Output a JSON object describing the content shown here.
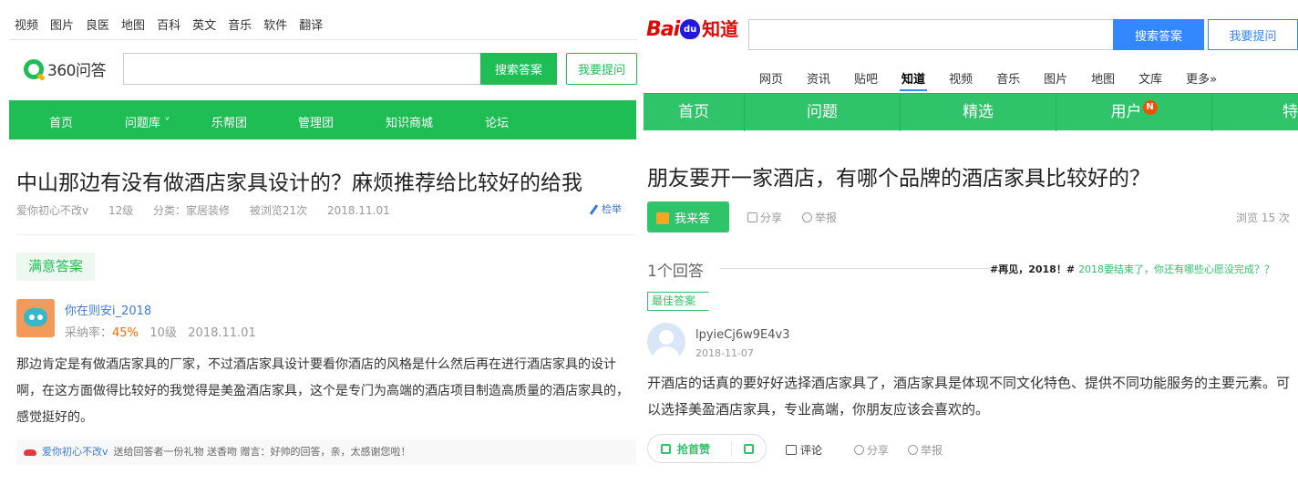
{
  "left": {
    "topnav": [
      "视频",
      "图片",
      "良医",
      "地图",
      "百科",
      "英文",
      "音乐",
      "软件",
      "翻译"
    ],
    "logo_text": "360问答",
    "search": {
      "placeholder": "",
      "button": "搜索答案"
    },
    "ask_button": "我要提问",
    "greenbar": [
      "首页",
      "问题库 ˅",
      "乐帮团",
      "管理团",
      "知识商城",
      "论坛"
    ],
    "question": {
      "title": "中山那边有没有做酒店家具设计的？麻烦推荐给比较好的给我",
      "author": "爱你初心不改v",
      "level": "12级",
      "category": "分类：家居装修",
      "views": "被浏览21次",
      "date": "2018.11.01",
      "report": "检举"
    },
    "best_label": "满意答案",
    "answerer": {
      "name": "你在则安i_2018",
      "adopt_label": "采纳率：",
      "adopt_rate": "45%",
      "level": "10级",
      "date": "2018.11.01"
    },
    "answer_text": "那边肯定是有做酒店家具的厂家，不过酒店家具设计要看你酒店的风格是什么然后再在进行酒店家具的设计啊，在这方面做得比较好的我觉得是美盈酒店家具，这个是专门为高端的酒店项目制造高质量的酒店家具的，感觉挺好的。",
    "gift": {
      "user": "爱你初心不改v",
      "text": "送给回答者一份礼物  送香吻  赠言：好帅的回答，亲，太感谢您啦！"
    }
  },
  "right": {
    "logo": {
      "bai": "Bai",
      "du": "du",
      "zhidao": "知道"
    },
    "search": {
      "placeholder": "",
      "button": "搜索答案"
    },
    "ask_button": "我要提问",
    "tabs": [
      "网页",
      "资讯",
      "贴吧",
      "知道",
      "视频",
      "音乐",
      "图片",
      "地图",
      "文库",
      "更多»"
    ],
    "active_tab": "知道",
    "greenbar": [
      "首页",
      "问题",
      "精选",
      "用户",
      "特"
    ],
    "badge": "N",
    "question": {
      "title": "朋友要开一家酒店，有哪个品牌的酒店家具比较好的？",
      "answer_button": "我来答",
      "share": "分享",
      "report": "举报",
      "views": "浏览 15 次"
    },
    "answer_count": "1个回答",
    "topic": {
      "tag": "#再见，2018！#",
      "text": "2018要结束了，你还有哪些心愿没完成？？"
    },
    "best_label": "最佳答案",
    "answerer": {
      "name": "lpyieCj6w9E4v3",
      "date": "2018-11-07"
    },
    "answer_text": "开酒店的话真的要好好选择酒店家具了，酒店家具是体现不同文化特色、提供不同功能服务的主要元素。可以选择美盈酒店家具，专业高端，你朋友应该会喜欢的。",
    "actions": {
      "like": "抢首赞",
      "comment": "评论",
      "share": "分享",
      "report": "举报"
    },
    "colors": {
      "green": "#2fc36a",
      "blue": "#3388ff",
      "red": "#e10602"
    }
  }
}
